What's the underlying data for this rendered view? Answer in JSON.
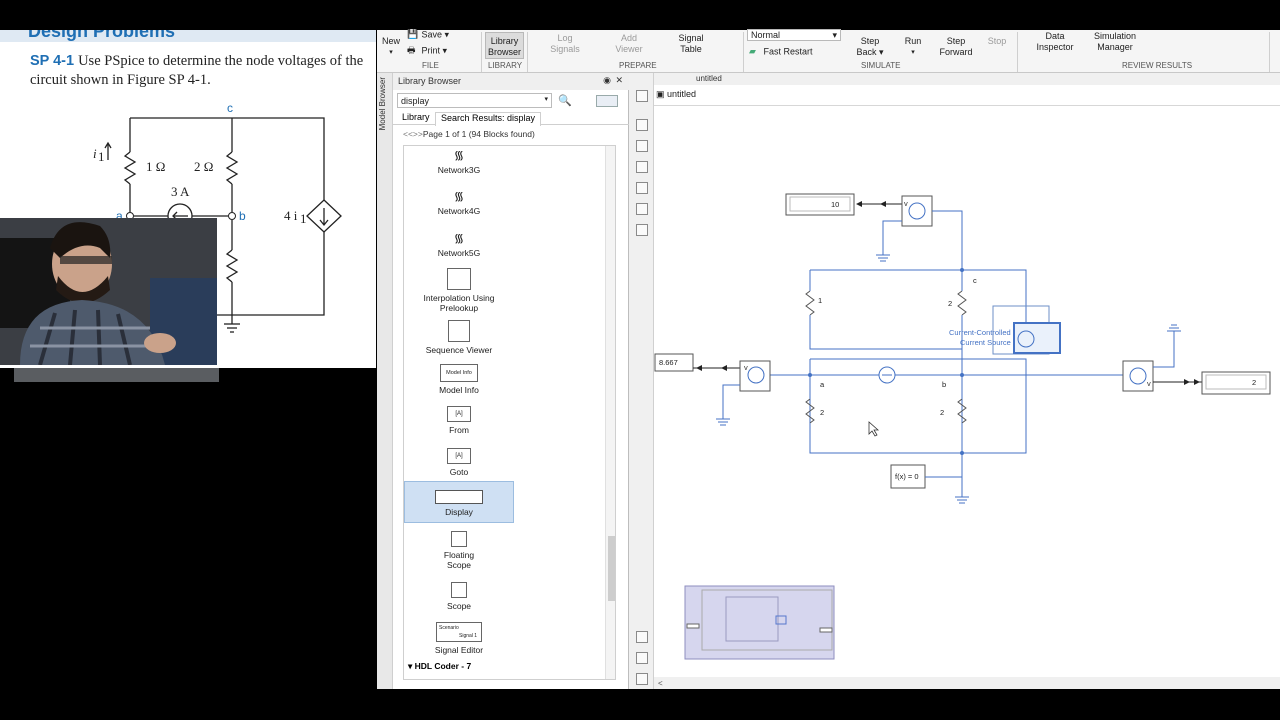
{
  "textbook": {
    "header": "Design Problems",
    "problem_number": "SP 4-1",
    "problem_text": "Use PSpice to determine the node voltages of the circuit shown in Figure SP 4-1.",
    "nodes": {
      "a": "a",
      "b": "b",
      "c": "c"
    },
    "labels": {
      "r1": "1 Ω",
      "r2": "2 Ω",
      "r3": "2 Ω",
      "r4": "2 Ω",
      "source": "3 A",
      "current": "i",
      "current_sub": "1",
      "dep_source": "4 i",
      "dep_sub": "1"
    }
  },
  "ribbon": {
    "file": {
      "new": "New",
      "save": "Save",
      "print": "Print",
      "section": "FILE"
    },
    "library": {
      "button": "Library Browser",
      "section": "LIBRARY"
    },
    "prepare": {
      "log_signals": "Log Signals",
      "add_viewer": "Add Viewer",
      "signal_table": "Signal Table",
      "section": "PREPARE"
    },
    "simulate": {
      "mode": "Normal",
      "fast_restart": "Fast Restart",
      "step_back": "Step Back",
      "run": "Run",
      "step_forward": "Step Forward",
      "stop": "Stop",
      "section": "SIMULATE"
    },
    "review": {
      "data_inspector": "Data Inspector",
      "simulation_manager": "Simulation Manager",
      "section": "REVIEW RESULTS"
    }
  },
  "model_browser": {
    "label": "Model Browser"
  },
  "library_browser": {
    "title": "Library Browser",
    "search_value": "display",
    "tabs": [
      "Library",
      "Search Results: display"
    ],
    "page_info": "Page 1 of 1 (94 Blocks found)",
    "items": [
      {
        "label": "Network3G",
        "icon": "wifi-icon"
      },
      {
        "label": "Network4G",
        "icon": "wifi-icon"
      },
      {
        "label": "Network5G",
        "icon": "wifi-icon"
      },
      {
        "label": "Interpolation Using Prelookup",
        "icon": "interpolation-icon"
      },
      {
        "label": "Sequence Viewer",
        "icon": "sequence-viewer-icon"
      },
      {
        "label": "Model Info",
        "icon": "model-info-icon"
      },
      {
        "label": "From",
        "icon": "from-icon"
      },
      {
        "label": "Goto",
        "icon": "goto-icon"
      },
      {
        "label": "Display",
        "icon": "display-icon"
      },
      {
        "label": "Floating Scope",
        "icon": "scope-icon"
      },
      {
        "label": "Scope",
        "icon": "scope-icon"
      },
      {
        "label": "Signal Editor",
        "icon": "signal-editor-icon"
      }
    ],
    "model_info_thumb": "Model Info",
    "signal_editor_thumb": "Scenario",
    "signal_editor_thumb2": "Signal 1",
    "tag_a": "[A]",
    "group": "HDL Coder - 7"
  },
  "canvas": {
    "breadcrumb": "untitled",
    "model_name": "untitled",
    "display_top": "10",
    "display_left": "8.667",
    "display_right": "2",
    "ccs_label1": "Current-Controlled",
    "ccs_label2": "Current Source",
    "solver_label": "f(x) = 0",
    "node_a": "a",
    "node_b": "b",
    "node_c": "c",
    "r_top_left": "1",
    "r_top_right": "2",
    "r_bot_left": "2",
    "r_bot_right": "2",
    "volt_v": "v"
  }
}
